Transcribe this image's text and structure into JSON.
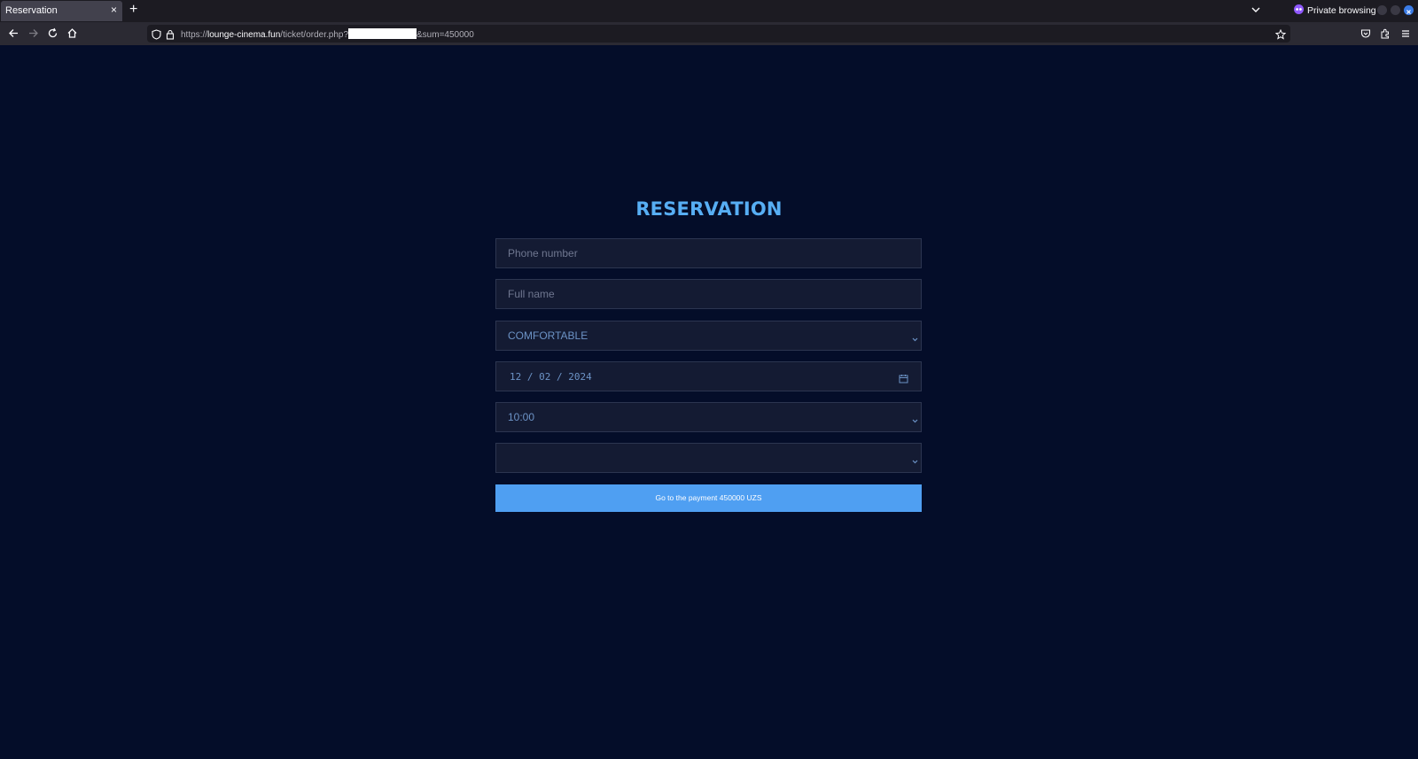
{
  "browser": {
    "tab_title": "Reservation",
    "tab_close": "×",
    "new_tab": "+",
    "private_label": "Private browsing",
    "url": {
      "scheme": "https://",
      "host": "lounge-cinema.fun",
      "path": "/ticket/order.php?",
      "query_tail": "&sum=450000"
    }
  },
  "page": {
    "title": "RESERVATION",
    "phone_placeholder": "Phone number",
    "name_placeholder": "Full name",
    "seat_type_value": "COMFORTABLE",
    "date_value": "12 / 02 / 2024",
    "time_value": "10:00",
    "extra_select_value": "",
    "pay_button_label": "Go to the payment 450000 UZS"
  },
  "colors": {
    "page_bg": "#040d29",
    "accent": "#4f9ff2",
    "title": "#57aef4"
  }
}
